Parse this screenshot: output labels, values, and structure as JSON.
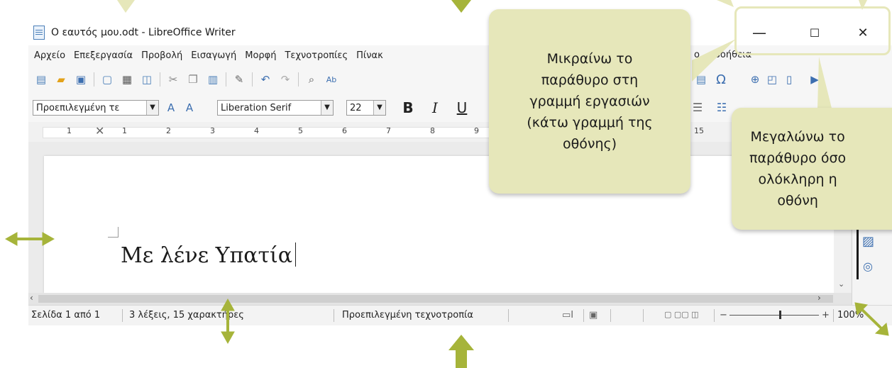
{
  "window": {
    "title": "Ο εαυτός μου.odt - LibreOffice Writer",
    "minimize_glyph": "—",
    "maximize_glyph": "☐",
    "close_glyph": "✕"
  },
  "menu": {
    "items": [
      "Αρχείο",
      "Επεξεργασία",
      "Προβολή",
      "Εισαγωγή",
      "Μορφή",
      "Τεχνοτροπίες",
      "Πίνακ"
    ],
    "partial_item": "ο",
    "help": "Βοήθεια"
  },
  "toolbar": {
    "icons": [
      "new-document-icon",
      "open-folder-icon",
      "save-icon",
      "export-pdf-icon",
      "print-icon",
      "print-preview-icon",
      "cut-icon",
      "copy-icon",
      "paste-icon",
      "clone-formatting-icon",
      "undo-icon",
      "redo-icon",
      "find-replace-icon",
      "spelling-icon"
    ],
    "special_char_glyph": "Ω"
  },
  "formatting": {
    "paragraph_style": "Προεπιλεγμένη τε",
    "font_name": "Liberation Serif",
    "font_size": "22",
    "bold": "B",
    "italic": "I",
    "underline": "U"
  },
  "ruler": {
    "numbers": [
      "1",
      "1",
      "2",
      "3",
      "4",
      "5",
      "6",
      "7",
      "8",
      "9",
      "15"
    ]
  },
  "document": {
    "text": "Με λένε Υπατία"
  },
  "statusbar": {
    "page": "Σελίδα 1 από 1",
    "words": "3 λέξεις, 15 χαρακτήρες",
    "style": "Προεπιλεγμένη τεχνοτροπία",
    "zoom": "100%"
  },
  "callouts": {
    "minimize": "Μικραίνω το\nπαράθυρο στη\nγραμμή εργασιών\n(κάτω γραμμή της\nοθόνης)",
    "maximize": "Μεγαλώνω το\nπαράθυρο όσο\nολόκληρη η\nοθόνη"
  },
  "colors": {
    "callout_fill": "#e6e7ba",
    "arrow": "#a6b43a"
  }
}
